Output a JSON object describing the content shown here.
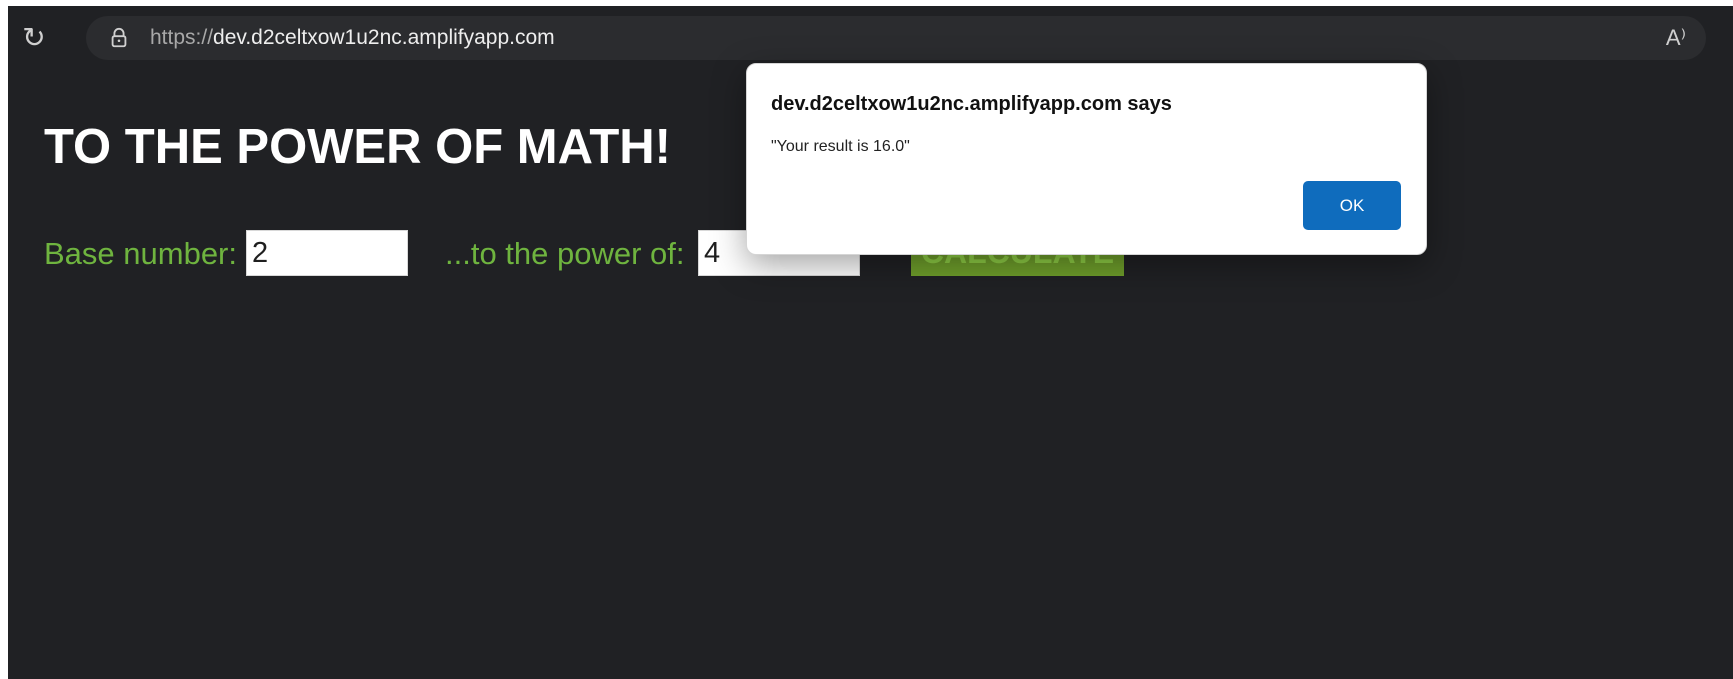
{
  "browser": {
    "reload_icon": "reload-icon",
    "lock_icon": "lock-icon",
    "url_scheme": "https://",
    "url_host": "dev.d2celtxow1u2nc.amplifyapp.com",
    "reader_label": "A⁾"
  },
  "page": {
    "title": "TO THE POWER OF MATH!",
    "base_label": "Base number:",
    "base_value": "2",
    "power_label": "...to the power of:",
    "power_value": "4",
    "calculate_label": "CALCULATE",
    "colors": {
      "background": "#202124",
      "accent": "#6fb43f",
      "button": "#6f9f2b"
    }
  },
  "dialog": {
    "title": "dev.d2celtxow1u2nc.amplifyapp.com says",
    "message": "\"Your result is 16.0\"",
    "ok_label": "OK",
    "ok_color": "#0f6cbd"
  }
}
